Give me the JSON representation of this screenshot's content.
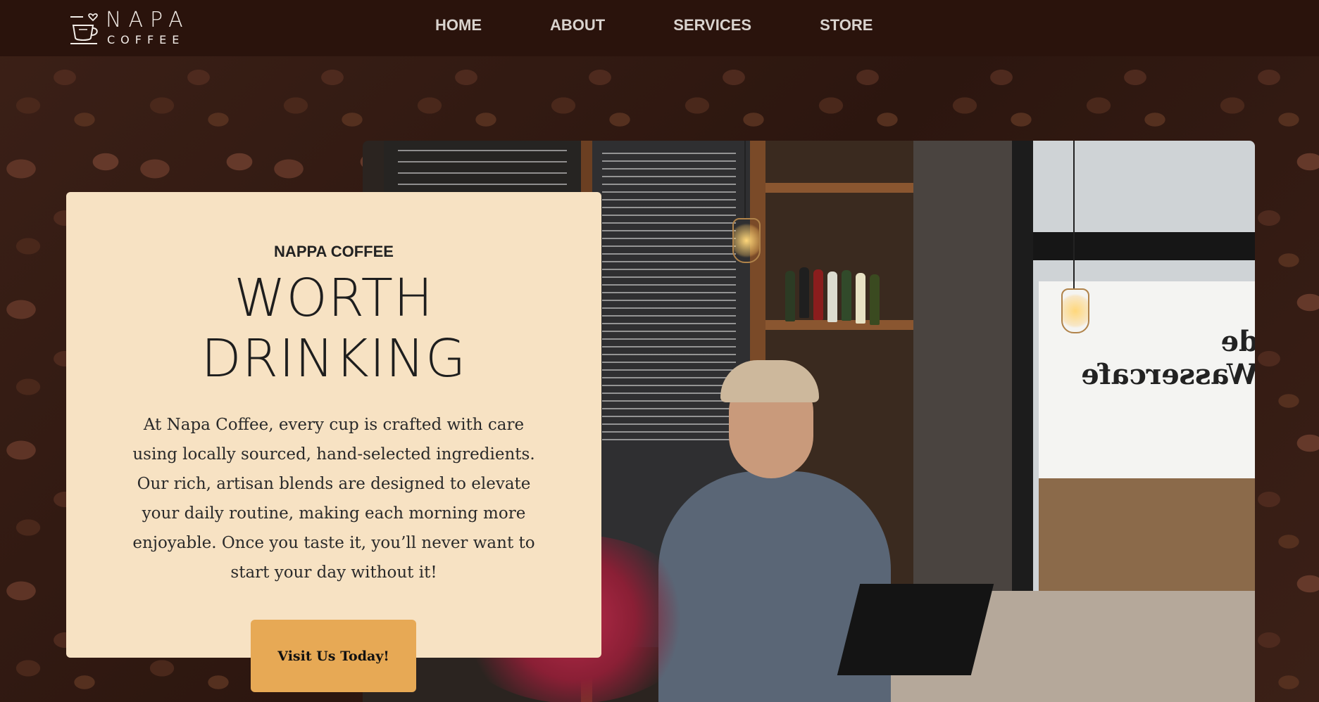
{
  "brand": {
    "name_top": "NAPA",
    "name_bottom": "COFFEE",
    "logo_icon": "coffee-cup-heart-icon"
  },
  "nav": {
    "items": [
      {
        "label": "HOME"
      },
      {
        "label": "ABOUT"
      },
      {
        "label": "SERVICES"
      },
      {
        "label": "STORE"
      }
    ]
  },
  "hero": {
    "eyebrow": "NAPPA COFFEE",
    "heading_line1": "WORTH",
    "heading_line2": "DRINKING",
    "body": "At Napa Coffee, every cup is crafted with care using locally sourced, hand-selected ingredients. Our rich, artisan blends are designed to elevate your daily routine, making each morning more enjoyable. Once you taste it, you’ll never want to start your day without it!",
    "cta_label": "Visit Us Today!"
  },
  "photo": {
    "window_sign": "de Wassercafe"
  },
  "colors": {
    "nav_bg": "#2a130c",
    "card_bg": "#f7e2c3",
    "cta_bg": "#e7a955",
    "background": "#3a1f16"
  }
}
